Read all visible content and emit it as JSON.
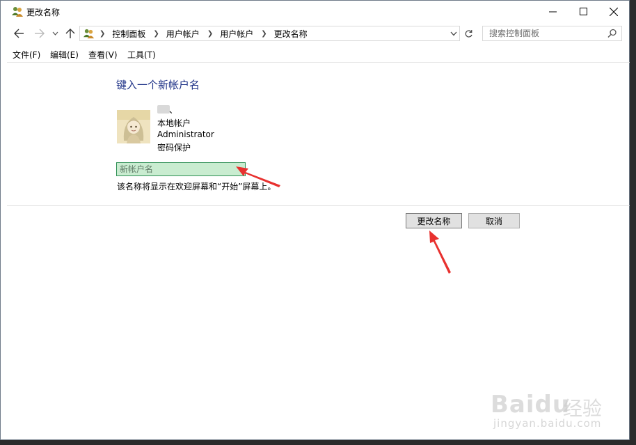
{
  "window": {
    "title": "更改名称",
    "colors": {
      "accent": "#1e3287",
      "input_bg": "#c9ecd0",
      "arrow": "#e8312f"
    }
  },
  "titlebar": {
    "minimize_icon": "minimize-icon",
    "maximize_icon": "maximize-icon",
    "close_icon": "close-icon"
  },
  "nav": {
    "back_icon": "back-arrow-icon",
    "forward_icon": "forward-arrow-icon",
    "recent_icon": "chevron-down-icon",
    "up_icon": "up-arrow-icon"
  },
  "address": {
    "crumbs": [
      "控制面板",
      "用户帐户",
      "用户帐户",
      "更改名称"
    ]
  },
  "search": {
    "placeholder": "搜索控制面板"
  },
  "menu": {
    "items": [
      "文件(F)",
      "编辑(E)",
      "查看(V)",
      "工具(T)"
    ]
  },
  "main": {
    "heading": "键入一个新帐户名",
    "account": {
      "name_suffix": "、",
      "type": "本地帐户",
      "role": "Administrator",
      "protection": "密码保护"
    },
    "new_name_placeholder": "新帐户名",
    "hint": "该名称将显示在欢迎屏幕和“开始”屏幕上。"
  },
  "buttons": {
    "change": "更改名称",
    "cancel": "取消"
  },
  "watermark": {
    "text": "jingyan.baidu.com",
    "logo": "Baidu",
    "logo_cn": "经验"
  }
}
